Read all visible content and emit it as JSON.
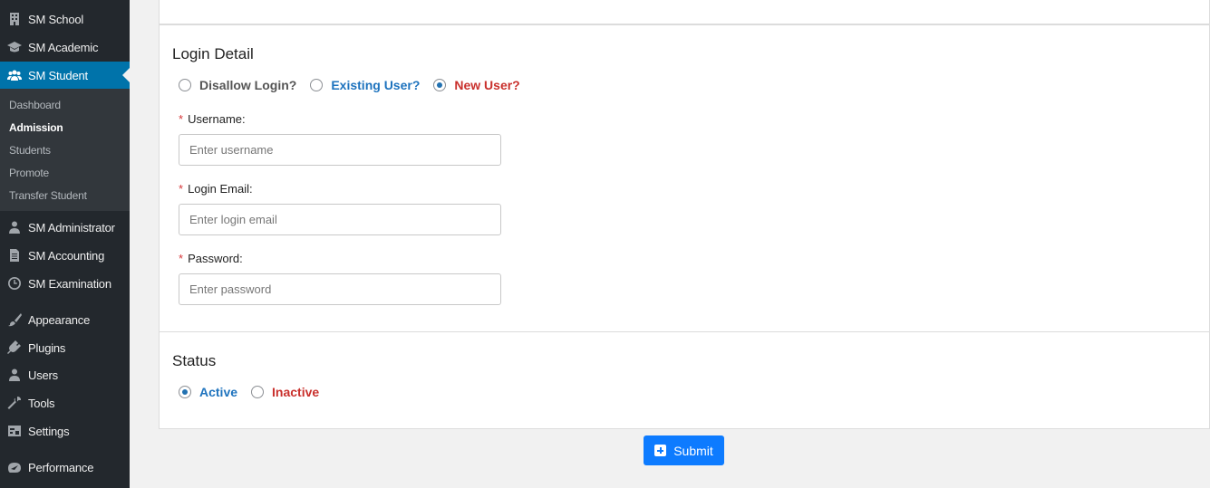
{
  "sidebar": {
    "top_items": [
      {
        "label": "SM School",
        "icon": "building-icon"
      },
      {
        "label": "SM Academic",
        "icon": "graduation-cap-icon"
      },
      {
        "label": "SM Student",
        "icon": "users-group-icon",
        "current": true
      }
    ],
    "submenu": [
      {
        "label": "Dashboard"
      },
      {
        "label": "Admission",
        "active": true
      },
      {
        "label": "Students"
      },
      {
        "label": "Promote"
      },
      {
        "label": "Transfer Student"
      }
    ],
    "bottom_items": [
      {
        "label": "SM Administrator",
        "icon": "user-icon"
      },
      {
        "label": "SM Accounting",
        "icon": "document-icon"
      },
      {
        "label": "SM Examination",
        "icon": "clock-icon"
      },
      {
        "label": "Appearance",
        "icon": "paintbrush-icon"
      },
      {
        "label": "Plugins",
        "icon": "plug-icon"
      },
      {
        "label": "Users",
        "icon": "users-icon"
      },
      {
        "label": "Tools",
        "icon": "wrench-icon"
      },
      {
        "label": "Settings",
        "icon": "settings-icon"
      },
      {
        "label": "Performance",
        "icon": "performance-icon"
      }
    ],
    "accent_color": "#0073aa"
  },
  "login_detail": {
    "title": "Login Detail",
    "options": [
      {
        "label": "Disallow Login?",
        "checked": false,
        "color": "#555555"
      },
      {
        "label": "Existing User?",
        "checked": false,
        "color": "#1e73be"
      },
      {
        "label": "New User?",
        "checked": true,
        "color": "#c9302c"
      }
    ],
    "username": {
      "label": "Username:",
      "placeholder": "Enter username",
      "required_mark": "*"
    },
    "login_email": {
      "label": "Login Email:",
      "placeholder": "Enter login email",
      "required_mark": "*"
    },
    "password": {
      "label": "Password:",
      "placeholder": "Enter password",
      "required_mark": "*"
    }
  },
  "status": {
    "title": "Status",
    "options": [
      {
        "label": "Active",
        "checked": true,
        "color": "#1e73be"
      },
      {
        "label": "Inactive",
        "checked": false,
        "color": "#c9302c"
      }
    ]
  },
  "submit": {
    "label": "Submit",
    "color": "#0d7bff"
  }
}
